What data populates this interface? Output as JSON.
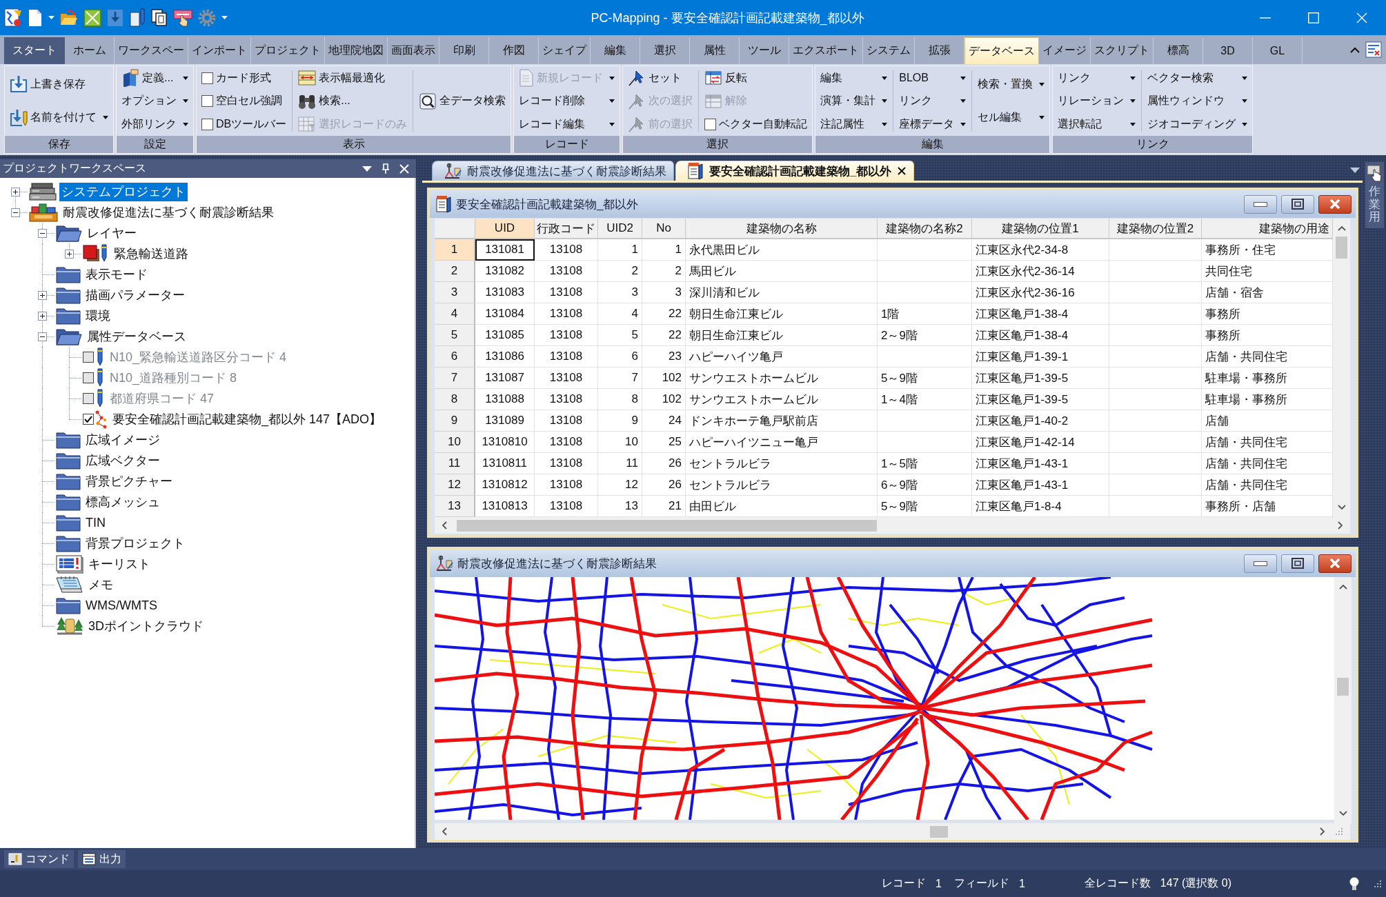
{
  "window": {
    "title": "PC-Mapping - 要安全確認計画記載建築物_都以外"
  },
  "ribbon": {
    "start_button": "スタート",
    "tabs": [
      {
        "label": "ホーム",
        "selected": false
      },
      {
        "label": "ワークスペー",
        "selected": false
      },
      {
        "label": "インポート",
        "selected": false
      },
      {
        "label": "プロジェクト",
        "selected": false
      },
      {
        "label": "地理院地図",
        "selected": false
      },
      {
        "label": "画面表示",
        "selected": false
      },
      {
        "label": "印刷",
        "selected": false
      },
      {
        "label": "作図",
        "selected": false
      },
      {
        "label": "シェイプ",
        "selected": false
      },
      {
        "label": "編集",
        "selected": false
      },
      {
        "label": "選択",
        "selected": false
      },
      {
        "label": "属性",
        "selected": false
      },
      {
        "label": "ツール",
        "selected": false
      },
      {
        "label": "エクスポート",
        "selected": false
      },
      {
        "label": "システム",
        "selected": false
      },
      {
        "label": "拡張",
        "selected": false
      },
      {
        "label": "データベース",
        "selected": true
      },
      {
        "label": "イメージ",
        "selected": false
      },
      {
        "label": "スクリプト",
        "selected": false
      },
      {
        "label": "標高",
        "selected": false
      },
      {
        "label": "3D",
        "selected": false
      },
      {
        "label": "GL",
        "selected": false
      }
    ],
    "groups": [
      {
        "label": "保存",
        "columns": [
          [
            {
              "kind": "command",
              "label": "上書き保存",
              "dropdown": false,
              "disabled": false
            },
            {
              "kind": "command",
              "label": "名前を付けて",
              "dropdown": true,
              "disabled": false
            }
          ]
        ]
      },
      {
        "label": "設定",
        "columns": [
          [
            {
              "kind": "command",
              "label": "定義...",
              "dropdown": true,
              "disabled": false
            },
            {
              "kind": "menu",
              "label": "オプション",
              "dropdown": true,
              "disabled": false
            },
            {
              "kind": "menu",
              "label": "外部リンク",
              "dropdown": true,
              "disabled": false
            }
          ]
        ]
      },
      {
        "label": "表示",
        "columns": [
          [
            {
              "kind": "checkbox",
              "label": "カード形式",
              "checked": false,
              "disabled": false
            },
            {
              "kind": "checkbox",
              "label": "空白セル強調",
              "checked": false,
              "disabled": false
            },
            {
              "kind": "checkbox",
              "label": "DBツールバー",
              "checked": false,
              "disabled": false
            }
          ],
          [
            {
              "kind": "command",
              "label": "表示幅最適化",
              "dropdown": false,
              "disabled": false
            },
            {
              "kind": "command",
              "label": "検索...",
              "dropdown": false,
              "disabled": false
            },
            {
              "kind": "command",
              "label": "選択レコードのみ",
              "dropdown": false,
              "disabled": true
            }
          ],
          [
            {
              "kind": "command",
              "label": "全データ検索",
              "dropdown": false,
              "disabled": false
            }
          ]
        ]
      },
      {
        "label": "レコード",
        "columns": [
          [
            {
              "kind": "command",
              "label": "新規レコード",
              "dropdown": true,
              "disabled": true
            },
            {
              "kind": "menu",
              "label": "レコード削除",
              "dropdown": true,
              "disabled": false
            },
            {
              "kind": "menu",
              "label": "レコード編集",
              "dropdown": true,
              "disabled": false
            }
          ]
        ]
      },
      {
        "label": "選択",
        "columns": [
          [
            {
              "kind": "command",
              "label": "セット",
              "dropdown": false,
              "disabled": false
            },
            {
              "kind": "command",
              "label": "次の選択",
              "dropdown": false,
              "disabled": true
            },
            {
              "kind": "command",
              "label": "前の選択",
              "dropdown": false,
              "disabled": true
            }
          ],
          [
            {
              "kind": "command",
              "label": "反転",
              "dropdown": false,
              "disabled": false
            },
            {
              "kind": "command",
              "label": "解除",
              "dropdown": false,
              "disabled": true
            },
            {
              "kind": "checkbox",
              "label": "ベクター自動転記",
              "checked": false,
              "disabled": false
            }
          ]
        ]
      },
      {
        "label": "編集",
        "columns": [
          [
            {
              "kind": "menu",
              "label": "編集",
              "dropdown": true,
              "disabled": false
            },
            {
              "kind": "menu",
              "label": "演算・集計",
              "dropdown": true,
              "disabled": false
            },
            {
              "kind": "menu",
              "label": "注記属性",
              "dropdown": true,
              "disabled": false
            }
          ],
          [
            {
              "kind": "menu",
              "label": "BLOB",
              "dropdown": true,
              "disabled": false
            },
            {
              "kind": "menu",
              "label": "リンク",
              "dropdown": true,
              "disabled": false
            },
            {
              "kind": "menu",
              "label": "座標データ",
              "dropdown": true,
              "disabled": false
            }
          ],
          [
            {
              "kind": "menu",
              "label": "検索・置換",
              "dropdown": true,
              "disabled": false
            },
            {
              "kind": "menu",
              "label": "セル編集",
              "dropdown": true,
              "disabled": false
            }
          ]
        ]
      },
      {
        "label": "リンク",
        "columns": [
          [
            {
              "kind": "menu",
              "label": "リンク",
              "dropdown": true,
              "disabled": false
            },
            {
              "kind": "menu",
              "label": "リレーション",
              "dropdown": true,
              "disabled": false
            },
            {
              "kind": "menu",
              "label": "選択転記",
              "dropdown": true,
              "disabled": false
            }
          ],
          [
            {
              "kind": "menu",
              "label": "ベクター検索",
              "dropdown": true,
              "disabled": false
            },
            {
              "kind": "menu",
              "label": "属性ウィンドウ",
              "dropdown": true,
              "disabled": false
            },
            {
              "kind": "menu",
              "label": "ジオコーディング",
              "dropdown": true,
              "disabled": false
            }
          ]
        ]
      }
    ]
  },
  "workspace": {
    "title": "プロジェクトワークスペース",
    "tree": [
      {
        "kind": "system",
        "label": "システムプロジェクト",
        "selected": true,
        "expanded": false
      },
      {
        "kind": "project",
        "label": "耐震改修促進法に基づく耐震診断結果",
        "selected": false,
        "expanded": true,
        "children": [
          {
            "kind": "folder",
            "label": "レイヤー",
            "selected": false,
            "expanded": true,
            "children": [
              {
                "kind": "layer",
                "label": "緊急輸送道路",
                "selected": false,
                "expanded": false
              }
            ]
          },
          {
            "kind": "folder",
            "label": "表示モード",
            "selected": false
          },
          {
            "kind": "folder",
            "label": "描画パラメーター",
            "selected": false,
            "expanded": false
          },
          {
            "kind": "folder",
            "label": "環境",
            "selected": false,
            "expanded": false
          },
          {
            "kind": "folder",
            "label": "属性データベース",
            "selected": false,
            "expanded": true,
            "children": [
              {
                "kind": "table",
                "label": "N10_緊急輸送道路区分コード 4",
                "selected": false,
                "checked": false
              },
              {
                "kind": "table",
                "label": "N10_道路種別コード 8",
                "selected": false,
                "checked": false
              },
              {
                "kind": "table",
                "label": "都道府県コード 47",
                "selected": false,
                "checked": false
              },
              {
                "kind": "point-table",
                "label": "要安全確認計画記載建築物_都以外 147【ADO】",
                "selected": false,
                "checked": true
              }
            ]
          },
          {
            "kind": "folder",
            "label": "広域イメージ",
            "selected": false
          },
          {
            "kind": "folder",
            "label": "広域ベクター",
            "selected": false
          },
          {
            "kind": "folder",
            "label": "背景ピクチャー",
            "selected": false
          },
          {
            "kind": "folder",
            "label": "標高メッシュ",
            "selected": false
          },
          {
            "kind": "folder",
            "label": "TIN",
            "selected": false
          },
          {
            "kind": "folder",
            "label": "背景プロジェクト",
            "selected": false
          },
          {
            "kind": "keylist",
            "label": "キーリスト",
            "selected": false
          },
          {
            "kind": "memo",
            "label": "メモ",
            "selected": false
          },
          {
            "kind": "folder",
            "label": "WMS/WMTS",
            "selected": false
          },
          {
            "kind": "pointcloud",
            "label": "3Dポイントクラウド",
            "selected": false
          }
        ]
      }
    ]
  },
  "document_tabs": [
    {
      "kind": "map",
      "label": "耐震改修促進法に基づく耐震診断結果",
      "selected": false
    },
    {
      "kind": "table",
      "label": "要安全確認計画記載建築物_都以外",
      "selected": true
    }
  ],
  "table_window": {
    "title": "要安全確認計画記載建築物_都以外",
    "table": {
      "columns": [
        {
          "label": "UID",
          "selected": true
        },
        {
          "label": "行政コード",
          "selected": false
        },
        {
          "label": "UID2",
          "selected": false
        },
        {
          "label": "No",
          "selected": false
        },
        {
          "label": "建築物の名称",
          "selected": false
        },
        {
          "label": "建築物の名称2",
          "selected": false
        },
        {
          "label": "建築物の位置1",
          "selected": false
        },
        {
          "label": "建築物の位置2",
          "selected": false
        },
        {
          "label": "建築物の用途",
          "selected": false
        }
      ],
      "rows": [
        {
          "number": "1",
          "selected": true,
          "cells": [
            "131081",
            "13108",
            "1",
            "1",
            "永代黒田ビル",
            null,
            "江東区永代2-34-8",
            null,
            "事務所・住宅"
          ]
        },
        {
          "number": "2",
          "selected": false,
          "cells": [
            "131082",
            "13108",
            "2",
            "2",
            "馬田ビル",
            null,
            "江東区永代2-36-14",
            null,
            "共同住宅"
          ]
        },
        {
          "number": "3",
          "selected": false,
          "cells": [
            "131083",
            "13108",
            "3",
            "3",
            "深川清和ビル",
            null,
            "江東区永代2-36-16",
            null,
            "店舗・宿舎"
          ]
        },
        {
          "number": "4",
          "selected": false,
          "cells": [
            "131084",
            "13108",
            "4",
            "22",
            "朝日生命江東ビル",
            "1階",
            "江東区亀戸1-38-4",
            null,
            "事務所"
          ]
        },
        {
          "number": "5",
          "selected": false,
          "cells": [
            "131085",
            "13108",
            "5",
            "22",
            "朝日生命江東ビル",
            "2～9階",
            "江東区亀戸1-38-4",
            null,
            "事務所"
          ]
        },
        {
          "number": "6",
          "selected": false,
          "cells": [
            "131086",
            "13108",
            "6",
            "23",
            "ハピーハイツ亀戸",
            null,
            "江東区亀戸1-39-1",
            null,
            "店舗・共同住宅"
          ]
        },
        {
          "number": "7",
          "selected": false,
          "cells": [
            "131087",
            "13108",
            "7",
            "102",
            "サンウエストホームビル",
            "5～9階",
            "江東区亀戸1-39-5",
            null,
            "駐車場・事務所"
          ]
        },
        {
          "number": "8",
          "selected": false,
          "cells": [
            "131088",
            "13108",
            "8",
            "102",
            "サンウエストホームビル",
            "1～4階",
            "江東区亀戸1-39-5",
            null,
            "駐車場・事務所"
          ]
        },
        {
          "number": "9",
          "selected": false,
          "cells": [
            "131089",
            "13108",
            "9",
            "24",
            "ドンキホーテ亀戸駅前店",
            null,
            "江東区亀戸1-40-2",
            null,
            "店舗"
          ]
        },
        {
          "number": "10",
          "selected": false,
          "cells": [
            "1310810",
            "13108",
            "10",
            "25",
            "ハピーハイツニュー亀戸",
            null,
            "江東区亀戸1-42-14",
            null,
            "店舗・共同住宅"
          ]
        },
        {
          "number": "11",
          "selected": false,
          "cells": [
            "1310811",
            "13108",
            "11",
            "26",
            "セントラルビラ",
            "1～5階",
            "江東区亀戸1-43-1",
            null,
            "店舗・共同住宅"
          ]
        },
        {
          "number": "12",
          "selected": false,
          "cells": [
            "1310812",
            "13108",
            "12",
            "26",
            "セントラルビラ",
            "6～9階",
            "江東区亀戸1-43-1",
            null,
            "店舗・共同住宅"
          ]
        },
        {
          "number": "13",
          "selected": false,
          "cells": [
            "1310813",
            "13108",
            "13",
            "21",
            "由田ビル",
            "5～9階",
            "江東区亀戸1-8-4",
            null,
            "事務所・店舗"
          ]
        }
      ]
    }
  },
  "map_window": {
    "title": "耐震改修促進法に基づく耐震診断結果"
  },
  "side_tab": {
    "label": "作業用"
  },
  "pane_tabs": [
    {
      "label": "コマンド",
      "selected": false
    },
    {
      "label": "出力",
      "selected": false
    }
  ],
  "status_bar": [
    {
      "label": "レコード",
      "value": "1"
    },
    {
      "label": "フィールド",
      "value": "1"
    },
    {
      "label": "全レコード数",
      "value": "147 (選択数 0)"
    }
  ]
}
